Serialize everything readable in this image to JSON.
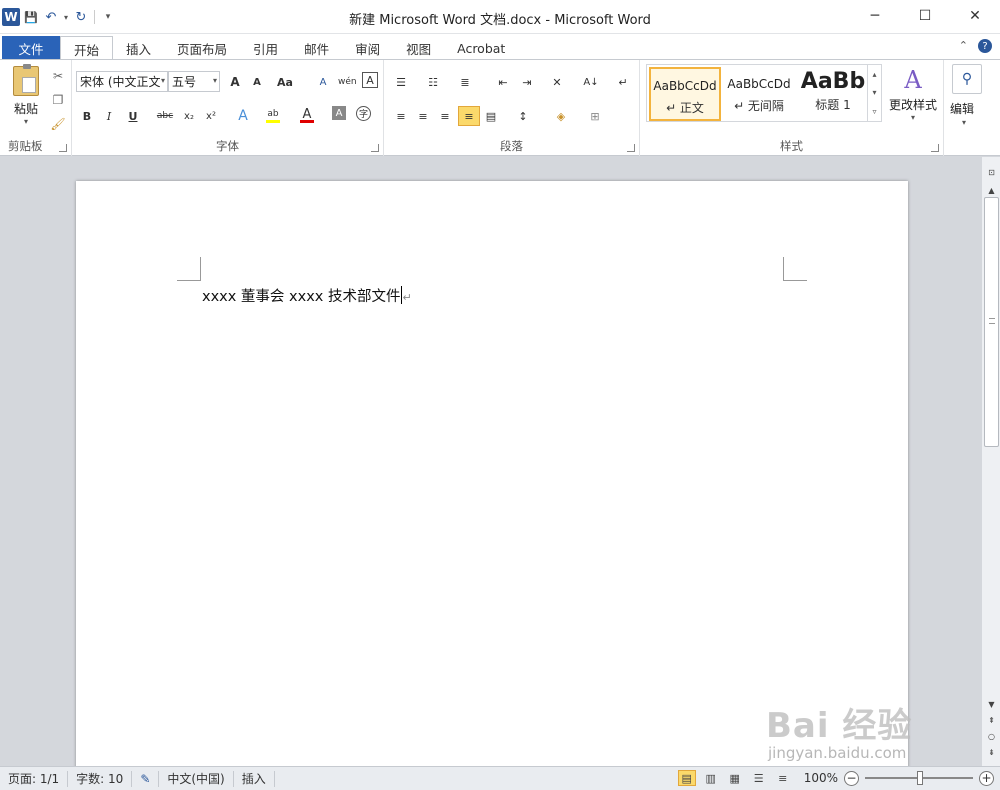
{
  "window": {
    "title": "新建 Microsoft Word 文档.docx - Microsoft Word",
    "app_icon": "W",
    "minimize": "─",
    "maximize": "☐",
    "close": "✕"
  },
  "qat": {
    "save": "💾",
    "undo": "↶",
    "redo": "↻",
    "customize": "▾"
  },
  "tabs": [
    "文件",
    "开始",
    "插入",
    "页面布局",
    "引用",
    "邮件",
    "审阅",
    "视图",
    "Acrobat"
  ],
  "ribbon": {
    "clipboard": {
      "label": "剪贴板",
      "paste": "粘贴"
    },
    "font": {
      "label": "字体",
      "font_name": "宋体 (中文正文",
      "font_size": "五号",
      "grow": "A",
      "shrink": "A",
      "case": "Aa",
      "bold": "B",
      "italic": "I",
      "underline": "U",
      "strike": "abc",
      "subscript": "x₂",
      "superscript": "x²",
      "highlight": "ab",
      "font_color": "A",
      "char_shade": "A",
      "enclose": "字",
      "clear": "A",
      "phonetic": "wén",
      "border_char": "A"
    },
    "paragraph": {
      "label": "段落",
      "sort": "A↓",
      "marks": "↵"
    },
    "styles": {
      "label": "样式",
      "items": [
        {
          "sample": "AaBbCcDd",
          "name": "↵ 正文"
        },
        {
          "sample": "AaBbCcDd",
          "name": "↵ 无间隔"
        },
        {
          "sample": "AaBb",
          "name": "标题 1"
        }
      ],
      "change": "更改样式"
    },
    "editing": {
      "label": "编辑"
    }
  },
  "document": {
    "text": "xxxx 董事会 xxxx 技术部文件",
    "para_mark": "↵"
  },
  "status": {
    "page": "页面: 1/1",
    "words": "字数: 10",
    "language": "中文(中国)",
    "mode": "插入",
    "zoom": "100%",
    "zoom_minus": "−",
    "zoom_plus": "+"
  },
  "watermark": {
    "main": "Bai 经验",
    "sub": "jingyan.baidu.com"
  },
  "colors": {
    "accent": "#2b579a",
    "file_tab": "#2a63b8",
    "highlight_yellow": "#ffff00",
    "font_red": "#e00000"
  }
}
